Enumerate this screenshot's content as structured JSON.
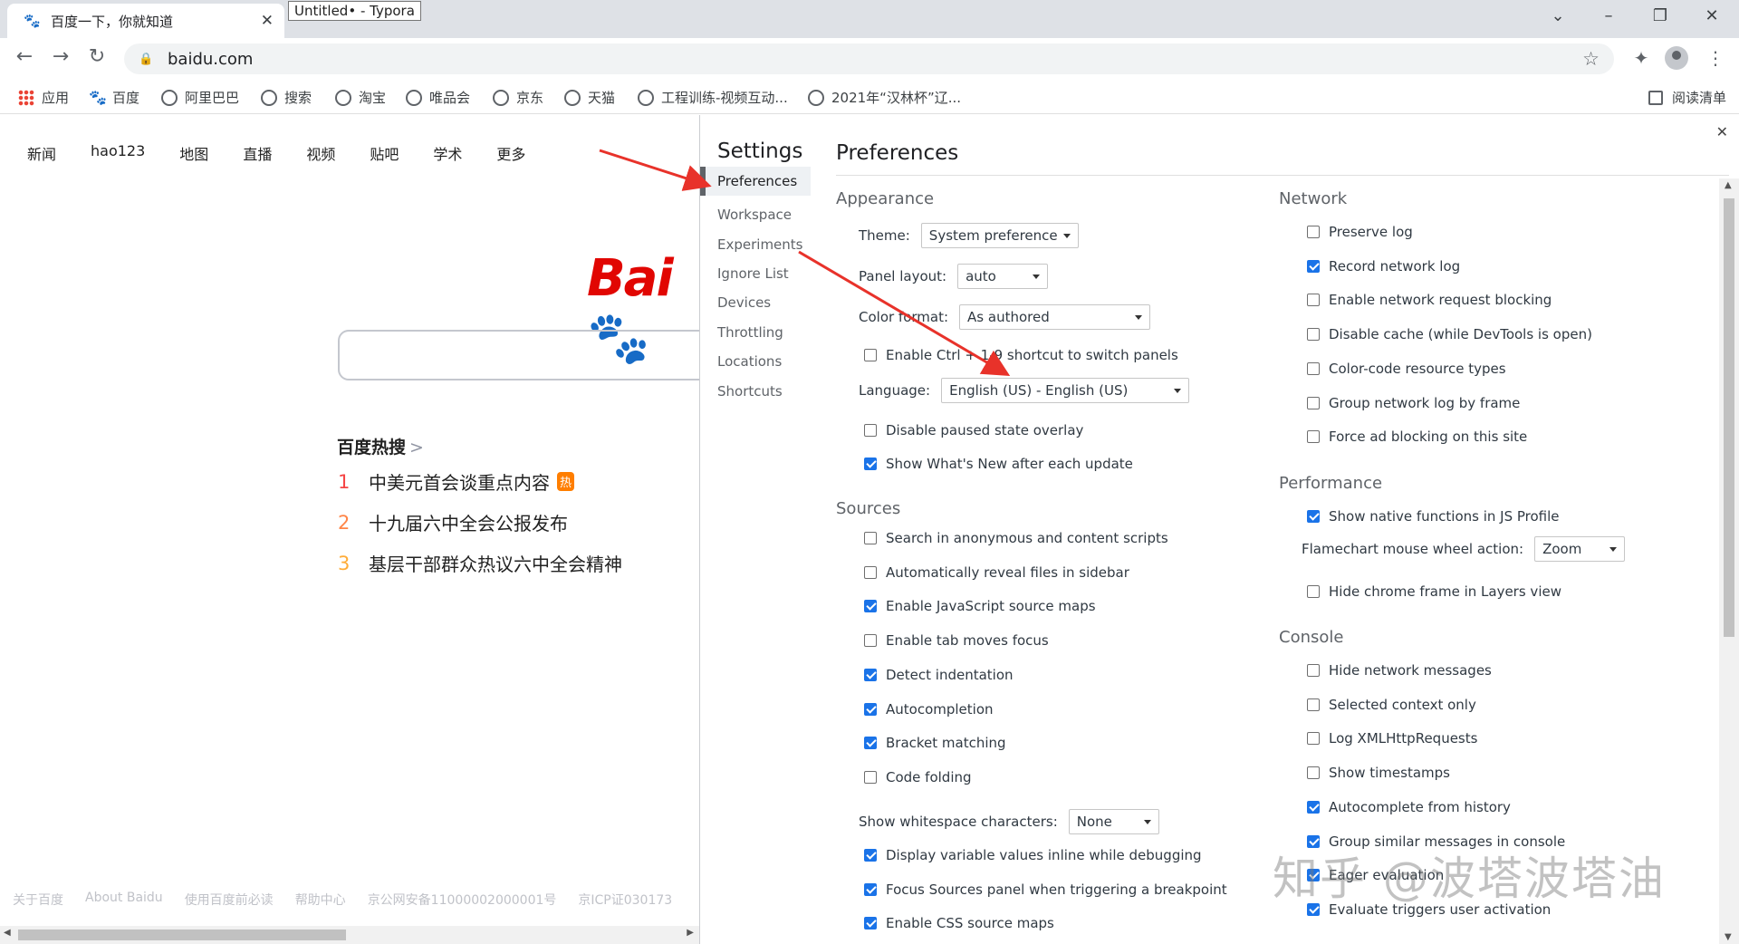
{
  "browser": {
    "tab_title": "百度一下，你就知道",
    "tooltip": "Untitled• - Typora",
    "url": "baidu.com",
    "bookmarks": [
      "应用",
      "百度",
      "阿里巴巴",
      "搜索",
      "淘宝",
      "唯品会",
      "京东",
      "天猫",
      "工程训练-视频互动...",
      "2021年“汉林杯”辽..."
    ],
    "reading_list": "阅读清单"
  },
  "baidu": {
    "nav": [
      "新闻",
      "hao123",
      "地图",
      "直播",
      "视频",
      "贴吧",
      "学术",
      "更多"
    ],
    "logo": "Bai",
    "hot_title": "百度热搜",
    "hot_items": [
      {
        "rank": "1",
        "text": "中美元首会谈重点内容",
        "badge": "热",
        "color": "#f54545"
      },
      {
        "rank": "2",
        "text": "十九届六中全会公报发布",
        "color": "#ff8547"
      },
      {
        "rank": "3",
        "text": "基层干部群众热议六中全会精神",
        "color": "#ffac38"
      }
    ],
    "footer": [
      "关于百度",
      "About Baidu",
      "使用百度前必读",
      "帮助中心",
      "京公网安备11000002000001号",
      "京ICP证030173"
    ]
  },
  "devtools": {
    "settings_title": "Settings",
    "sidebar": [
      "Preferences",
      "Workspace",
      "Experiments",
      "Ignore List",
      "Devices",
      "Throttling",
      "Locations",
      "Shortcuts"
    ],
    "panel_title": "Preferences",
    "appearance": {
      "heading": "Appearance",
      "theme_label": "Theme:",
      "theme_value": "System preference",
      "layout_label": "Panel layout:",
      "layout_value": "auto",
      "color_label": "Color format:",
      "color_value": "As authored",
      "ctrl_label": "Enable Ctrl + 1-9 shortcut to switch panels",
      "lang_label": "Language:",
      "lang_value": "English (US) - English (US)",
      "paused_label": "Disable paused state overlay",
      "whatsnew_label": "Show What's New after each update"
    },
    "sources": {
      "heading": "Sources",
      "items": [
        {
          "label": "Search in anonymous and content scripts",
          "checked": false
        },
        {
          "label": "Automatically reveal files in sidebar",
          "checked": false
        },
        {
          "label": "Enable JavaScript source maps",
          "checked": true
        },
        {
          "label": "Enable tab moves focus",
          "checked": false
        },
        {
          "label": "Detect indentation",
          "checked": true
        },
        {
          "label": "Autocompletion",
          "checked": true
        },
        {
          "label": "Bracket matching",
          "checked": true
        },
        {
          "label": "Code folding",
          "checked": false
        }
      ],
      "whitespace_label": "Show whitespace characters:",
      "whitespace_value": "None",
      "items2": [
        {
          "label": "Display variable values inline while debugging",
          "checked": true
        },
        {
          "label": "Focus Sources panel when triggering a breakpoint",
          "checked": true
        },
        {
          "label": "Enable CSS source maps",
          "checked": true
        }
      ]
    },
    "network": {
      "heading": "Network",
      "items": [
        {
          "label": "Preserve log",
          "checked": false
        },
        {
          "label": "Record network log",
          "checked": true
        },
        {
          "label": "Enable network request blocking",
          "checked": false
        },
        {
          "label": "Disable cache (while DevTools is open)",
          "checked": false
        },
        {
          "label": "Color-code resource types",
          "checked": false
        },
        {
          "label": "Group network log by frame",
          "checked": false
        },
        {
          "label": "Force ad blocking on this site",
          "checked": false
        }
      ]
    },
    "performance": {
      "heading": "Performance",
      "native_label": "Show native functions in JS Profile",
      "flame_label": "Flamechart mouse wheel action:",
      "flame_value": "Zoom",
      "hide_chrome_label": "Hide chrome frame in Layers view"
    },
    "console": {
      "heading": "Console",
      "items": [
        {
          "label": "Hide network messages",
          "checked": false
        },
        {
          "label": "Selected context only",
          "checked": false
        },
        {
          "label": "Log XMLHttpRequests",
          "checked": false
        },
        {
          "label": "Show timestamps",
          "checked": false
        },
        {
          "label": "Autocomplete from history",
          "checked": true
        },
        {
          "label": "Group similar messages in console",
          "checked": true
        },
        {
          "label": "Eager evaluation",
          "checked": true
        },
        {
          "label": "Evaluate triggers user activation",
          "checked": true
        }
      ]
    }
  },
  "watermark": "知乎 @波塔波塔油",
  "colors": {
    "accent": "#1a73e8",
    "baidu_red": "#e10602",
    "baidu_blue": "#2932e1",
    "arrow": "#e8322a"
  }
}
